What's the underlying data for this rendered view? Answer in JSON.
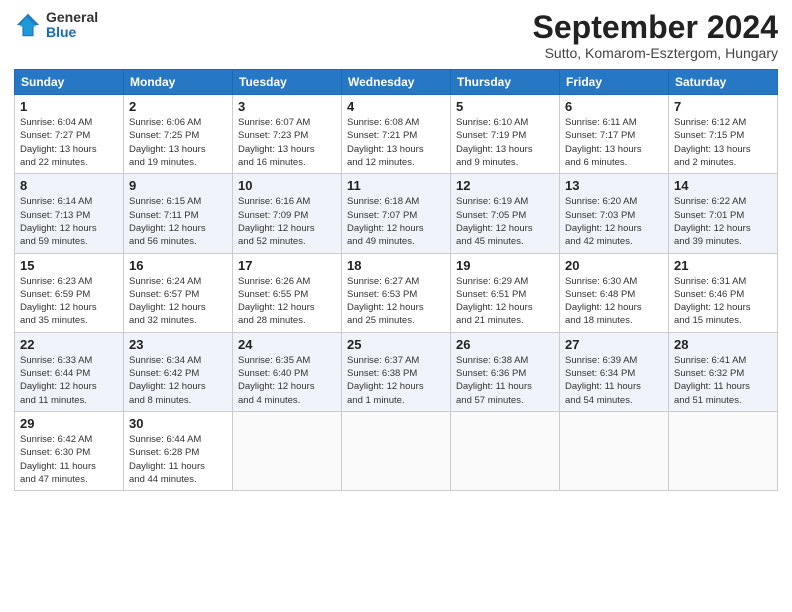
{
  "header": {
    "logo_general": "General",
    "logo_blue": "Blue",
    "month": "September 2024",
    "location": "Sutto, Komarom-Esztergom, Hungary"
  },
  "days_of_week": [
    "Sunday",
    "Monday",
    "Tuesday",
    "Wednesday",
    "Thursday",
    "Friday",
    "Saturday"
  ],
  "weeks": [
    [
      {
        "day": "1",
        "lines": [
          "Sunrise: 6:04 AM",
          "Sunset: 7:27 PM",
          "Daylight: 13 hours",
          "and 22 minutes."
        ]
      },
      {
        "day": "2",
        "lines": [
          "Sunrise: 6:06 AM",
          "Sunset: 7:25 PM",
          "Daylight: 13 hours",
          "and 19 minutes."
        ]
      },
      {
        "day": "3",
        "lines": [
          "Sunrise: 6:07 AM",
          "Sunset: 7:23 PM",
          "Daylight: 13 hours",
          "and 16 minutes."
        ]
      },
      {
        "day": "4",
        "lines": [
          "Sunrise: 6:08 AM",
          "Sunset: 7:21 PM",
          "Daylight: 13 hours",
          "and 12 minutes."
        ]
      },
      {
        "day": "5",
        "lines": [
          "Sunrise: 6:10 AM",
          "Sunset: 7:19 PM",
          "Daylight: 13 hours",
          "and 9 minutes."
        ]
      },
      {
        "day": "6",
        "lines": [
          "Sunrise: 6:11 AM",
          "Sunset: 7:17 PM",
          "Daylight: 13 hours",
          "and 6 minutes."
        ]
      },
      {
        "day": "7",
        "lines": [
          "Sunrise: 6:12 AM",
          "Sunset: 7:15 PM",
          "Daylight: 13 hours",
          "and 2 minutes."
        ]
      }
    ],
    [
      {
        "day": "8",
        "lines": [
          "Sunrise: 6:14 AM",
          "Sunset: 7:13 PM",
          "Daylight: 12 hours",
          "and 59 minutes."
        ]
      },
      {
        "day": "9",
        "lines": [
          "Sunrise: 6:15 AM",
          "Sunset: 7:11 PM",
          "Daylight: 12 hours",
          "and 56 minutes."
        ]
      },
      {
        "day": "10",
        "lines": [
          "Sunrise: 6:16 AM",
          "Sunset: 7:09 PM",
          "Daylight: 12 hours",
          "and 52 minutes."
        ]
      },
      {
        "day": "11",
        "lines": [
          "Sunrise: 6:18 AM",
          "Sunset: 7:07 PM",
          "Daylight: 12 hours",
          "and 49 minutes."
        ]
      },
      {
        "day": "12",
        "lines": [
          "Sunrise: 6:19 AM",
          "Sunset: 7:05 PM",
          "Daylight: 12 hours",
          "and 45 minutes."
        ]
      },
      {
        "day": "13",
        "lines": [
          "Sunrise: 6:20 AM",
          "Sunset: 7:03 PM",
          "Daylight: 12 hours",
          "and 42 minutes."
        ]
      },
      {
        "day": "14",
        "lines": [
          "Sunrise: 6:22 AM",
          "Sunset: 7:01 PM",
          "Daylight: 12 hours",
          "and 39 minutes."
        ]
      }
    ],
    [
      {
        "day": "15",
        "lines": [
          "Sunrise: 6:23 AM",
          "Sunset: 6:59 PM",
          "Daylight: 12 hours",
          "and 35 minutes."
        ]
      },
      {
        "day": "16",
        "lines": [
          "Sunrise: 6:24 AM",
          "Sunset: 6:57 PM",
          "Daylight: 12 hours",
          "and 32 minutes."
        ]
      },
      {
        "day": "17",
        "lines": [
          "Sunrise: 6:26 AM",
          "Sunset: 6:55 PM",
          "Daylight: 12 hours",
          "and 28 minutes."
        ]
      },
      {
        "day": "18",
        "lines": [
          "Sunrise: 6:27 AM",
          "Sunset: 6:53 PM",
          "Daylight: 12 hours",
          "and 25 minutes."
        ]
      },
      {
        "day": "19",
        "lines": [
          "Sunrise: 6:29 AM",
          "Sunset: 6:51 PM",
          "Daylight: 12 hours",
          "and 21 minutes."
        ]
      },
      {
        "day": "20",
        "lines": [
          "Sunrise: 6:30 AM",
          "Sunset: 6:48 PM",
          "Daylight: 12 hours",
          "and 18 minutes."
        ]
      },
      {
        "day": "21",
        "lines": [
          "Sunrise: 6:31 AM",
          "Sunset: 6:46 PM",
          "Daylight: 12 hours",
          "and 15 minutes."
        ]
      }
    ],
    [
      {
        "day": "22",
        "lines": [
          "Sunrise: 6:33 AM",
          "Sunset: 6:44 PM",
          "Daylight: 12 hours",
          "and 11 minutes."
        ]
      },
      {
        "day": "23",
        "lines": [
          "Sunrise: 6:34 AM",
          "Sunset: 6:42 PM",
          "Daylight: 12 hours",
          "and 8 minutes."
        ]
      },
      {
        "day": "24",
        "lines": [
          "Sunrise: 6:35 AM",
          "Sunset: 6:40 PM",
          "Daylight: 12 hours",
          "and 4 minutes."
        ]
      },
      {
        "day": "25",
        "lines": [
          "Sunrise: 6:37 AM",
          "Sunset: 6:38 PM",
          "Daylight: 12 hours",
          "and 1 minute."
        ]
      },
      {
        "day": "26",
        "lines": [
          "Sunrise: 6:38 AM",
          "Sunset: 6:36 PM",
          "Daylight: 11 hours",
          "and 57 minutes."
        ]
      },
      {
        "day": "27",
        "lines": [
          "Sunrise: 6:39 AM",
          "Sunset: 6:34 PM",
          "Daylight: 11 hours",
          "and 54 minutes."
        ]
      },
      {
        "day": "28",
        "lines": [
          "Sunrise: 6:41 AM",
          "Sunset: 6:32 PM",
          "Daylight: 11 hours",
          "and 51 minutes."
        ]
      }
    ],
    [
      {
        "day": "29",
        "lines": [
          "Sunrise: 6:42 AM",
          "Sunset: 6:30 PM",
          "Daylight: 11 hours",
          "and 47 minutes."
        ]
      },
      {
        "day": "30",
        "lines": [
          "Sunrise: 6:44 AM",
          "Sunset: 6:28 PM",
          "Daylight: 11 hours",
          "and 44 minutes."
        ]
      },
      {
        "day": "",
        "lines": []
      },
      {
        "day": "",
        "lines": []
      },
      {
        "day": "",
        "lines": []
      },
      {
        "day": "",
        "lines": []
      },
      {
        "day": "",
        "lines": []
      }
    ]
  ]
}
